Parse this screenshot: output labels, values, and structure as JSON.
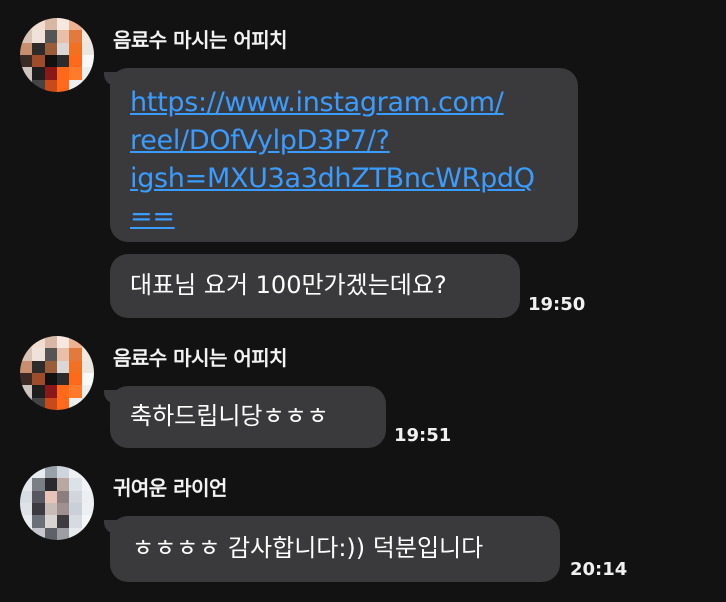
{
  "messages": {
    "group1": {
      "sender": "음료수 마시는 어피치",
      "link_lines": [
        "https://www.instagram.com/",
        "reel/DOfVylpD3P7/?",
        "igsh=MXU3a3dhZTBncWRpdQ",
        "=="
      ],
      "text": "대표님 요거 100만가겠는데요?",
      "time": "19:50"
    },
    "group2": {
      "sender": "음료수 마시는 어피치",
      "text": "축하드립니당ㅎㅎㅎ",
      "time": "19:51"
    },
    "group3": {
      "sender": "귀여운 라이언",
      "text": "ㅎㅎㅎㅎ 감사합니다:)) 덕분입니다",
      "time": "20:14"
    }
  },
  "colors": {
    "background": "#121213",
    "bubble": "#3a3a3c",
    "link": "#3b9cff"
  },
  "icons": {
    "avatar_apeach": "pixelated-apeach-avatar",
    "avatar_ryan": "pixelated-ryan-avatar"
  }
}
